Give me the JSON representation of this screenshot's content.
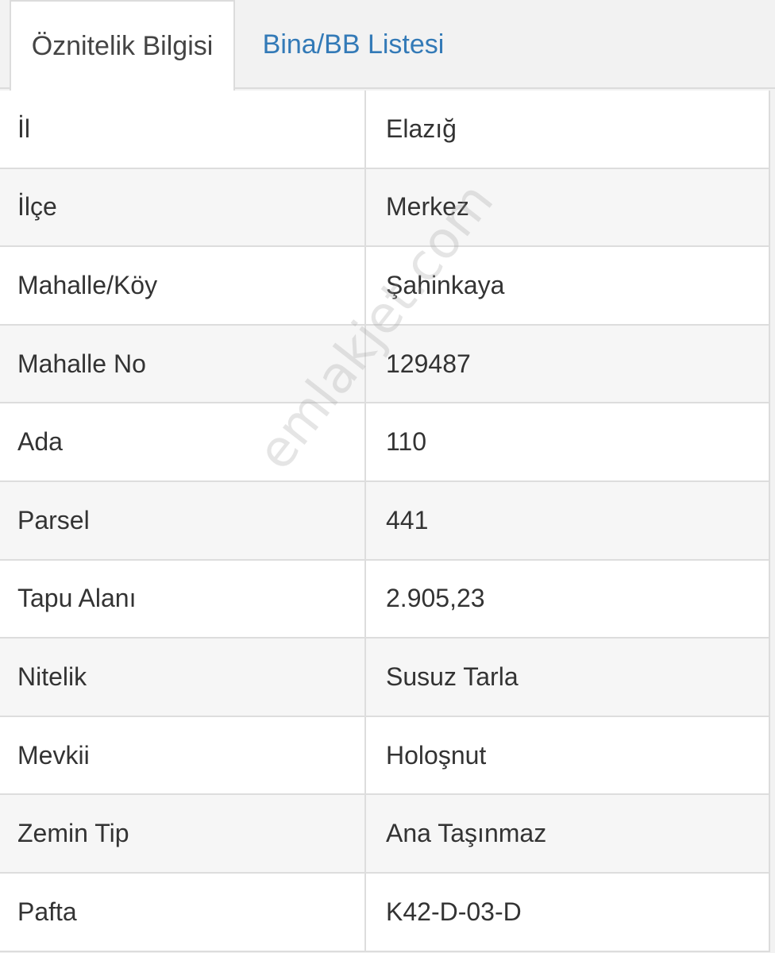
{
  "tabs": [
    {
      "label": "Öznitelik Bilgisi",
      "active": true
    },
    {
      "label": "Bina/BB Listesi",
      "active": false
    }
  ],
  "attributes": [
    {
      "key": "İl",
      "value": "Elazığ"
    },
    {
      "key": "İlçe",
      "value": "Merkez"
    },
    {
      "key": "Mahalle/Köy",
      "value": "Şahinkaya"
    },
    {
      "key": "Mahalle No",
      "value": "129487"
    },
    {
      "key": "Ada",
      "value": "110"
    },
    {
      "key": "Parsel",
      "value": "441"
    },
    {
      "key": "Tapu Alanı",
      "value": "2.905,23"
    },
    {
      "key": "Nitelik",
      "value": "Susuz Tarla"
    },
    {
      "key": "Mevkii",
      "value": "Holoşnut"
    },
    {
      "key": "Zemin Tip",
      "value": "Ana Taşınmaz"
    },
    {
      "key": "Pafta",
      "value": "K42-D-03-D"
    }
  ],
  "watermark": "emlakjet.com",
  "colors": {
    "tab_link": "#337ab7",
    "text": "#333333",
    "border": "#dddddd"
  }
}
